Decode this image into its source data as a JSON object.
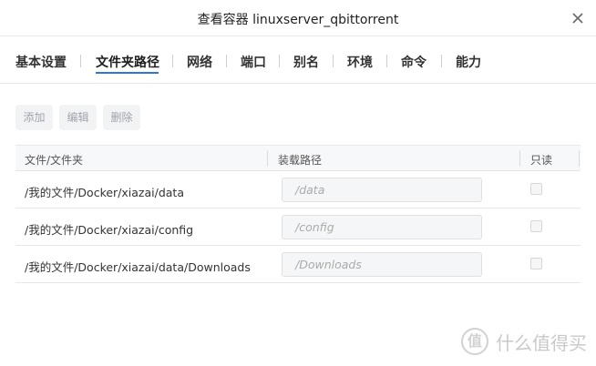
{
  "dialog": {
    "title": "查看容器 linuxserver_qbittorrent",
    "close_icon": "close-icon"
  },
  "tabs": [
    {
      "label": "基本设置",
      "active": false
    },
    {
      "label": "文件夹路径",
      "active": true
    },
    {
      "label": "网络",
      "active": false
    },
    {
      "label": "端口",
      "active": false
    },
    {
      "label": "别名",
      "active": false
    },
    {
      "label": "环境",
      "active": false
    },
    {
      "label": "命令",
      "active": false
    },
    {
      "label": "能力",
      "active": false
    }
  ],
  "toolbar": {
    "add_label": "添加",
    "edit_label": "编辑",
    "delete_label": "删除"
  },
  "table": {
    "headers": [
      "文件/文件夹",
      "装载路径",
      "只读"
    ],
    "rows": [
      {
        "path": "/我的文件/Docker/xiazai/data",
        "mount": "/data",
        "readonly": false
      },
      {
        "path": "/我的文件/Docker/xiazai/config",
        "mount": "/config",
        "readonly": false
      },
      {
        "path": "/我的文件/Docker/xiazai/data/Downloads",
        "mount": "/Downloads",
        "readonly": false
      }
    ]
  },
  "watermark": {
    "logo_glyph": "值",
    "text": "什么值得买"
  },
  "colors": {
    "accent": "#2f74d8"
  }
}
